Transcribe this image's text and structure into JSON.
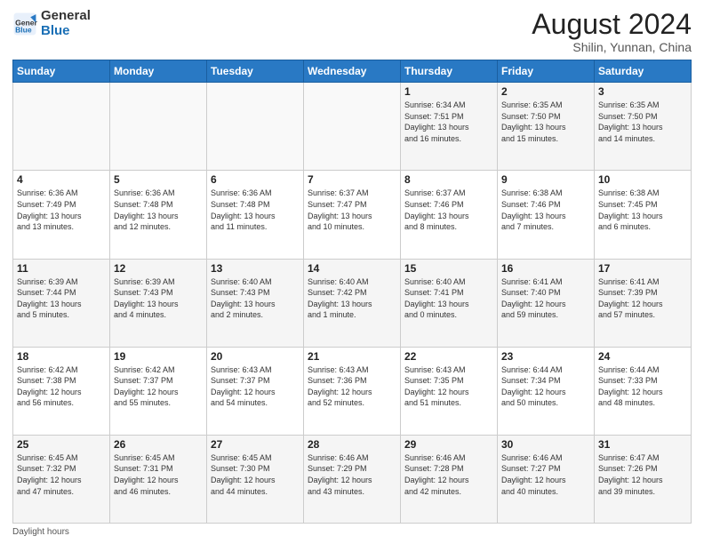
{
  "header": {
    "logo_line1": "General",
    "logo_line2": "Blue",
    "main_title": "August 2024",
    "sub_title": "Shilin, Yunnan, China"
  },
  "days_of_week": [
    "Sunday",
    "Monday",
    "Tuesday",
    "Wednesday",
    "Thursday",
    "Friday",
    "Saturday"
  ],
  "weeks": [
    [
      {
        "day": "",
        "detail": ""
      },
      {
        "day": "",
        "detail": ""
      },
      {
        "day": "",
        "detail": ""
      },
      {
        "day": "",
        "detail": ""
      },
      {
        "day": "1",
        "detail": "Sunrise: 6:34 AM\nSunset: 7:51 PM\nDaylight: 13 hours\nand 16 minutes."
      },
      {
        "day": "2",
        "detail": "Sunrise: 6:35 AM\nSunset: 7:50 PM\nDaylight: 13 hours\nand 15 minutes."
      },
      {
        "day": "3",
        "detail": "Sunrise: 6:35 AM\nSunset: 7:50 PM\nDaylight: 13 hours\nand 14 minutes."
      }
    ],
    [
      {
        "day": "4",
        "detail": "Sunrise: 6:36 AM\nSunset: 7:49 PM\nDaylight: 13 hours\nand 13 minutes."
      },
      {
        "day": "5",
        "detail": "Sunrise: 6:36 AM\nSunset: 7:48 PM\nDaylight: 13 hours\nand 12 minutes."
      },
      {
        "day": "6",
        "detail": "Sunrise: 6:36 AM\nSunset: 7:48 PM\nDaylight: 13 hours\nand 11 minutes."
      },
      {
        "day": "7",
        "detail": "Sunrise: 6:37 AM\nSunset: 7:47 PM\nDaylight: 13 hours\nand 10 minutes."
      },
      {
        "day": "8",
        "detail": "Sunrise: 6:37 AM\nSunset: 7:46 PM\nDaylight: 13 hours\nand 8 minutes."
      },
      {
        "day": "9",
        "detail": "Sunrise: 6:38 AM\nSunset: 7:46 PM\nDaylight: 13 hours\nand 7 minutes."
      },
      {
        "day": "10",
        "detail": "Sunrise: 6:38 AM\nSunset: 7:45 PM\nDaylight: 13 hours\nand 6 minutes."
      }
    ],
    [
      {
        "day": "11",
        "detail": "Sunrise: 6:39 AM\nSunset: 7:44 PM\nDaylight: 13 hours\nand 5 minutes."
      },
      {
        "day": "12",
        "detail": "Sunrise: 6:39 AM\nSunset: 7:43 PM\nDaylight: 13 hours\nand 4 minutes."
      },
      {
        "day": "13",
        "detail": "Sunrise: 6:40 AM\nSunset: 7:43 PM\nDaylight: 13 hours\nand 2 minutes."
      },
      {
        "day": "14",
        "detail": "Sunrise: 6:40 AM\nSunset: 7:42 PM\nDaylight: 13 hours\nand 1 minute."
      },
      {
        "day": "15",
        "detail": "Sunrise: 6:40 AM\nSunset: 7:41 PM\nDaylight: 13 hours\nand 0 minutes."
      },
      {
        "day": "16",
        "detail": "Sunrise: 6:41 AM\nSunset: 7:40 PM\nDaylight: 12 hours\nand 59 minutes."
      },
      {
        "day": "17",
        "detail": "Sunrise: 6:41 AM\nSunset: 7:39 PM\nDaylight: 12 hours\nand 57 minutes."
      }
    ],
    [
      {
        "day": "18",
        "detail": "Sunrise: 6:42 AM\nSunset: 7:38 PM\nDaylight: 12 hours\nand 56 minutes."
      },
      {
        "day": "19",
        "detail": "Sunrise: 6:42 AM\nSunset: 7:37 PM\nDaylight: 12 hours\nand 55 minutes."
      },
      {
        "day": "20",
        "detail": "Sunrise: 6:43 AM\nSunset: 7:37 PM\nDaylight: 12 hours\nand 54 minutes."
      },
      {
        "day": "21",
        "detail": "Sunrise: 6:43 AM\nSunset: 7:36 PM\nDaylight: 12 hours\nand 52 minutes."
      },
      {
        "day": "22",
        "detail": "Sunrise: 6:43 AM\nSunset: 7:35 PM\nDaylight: 12 hours\nand 51 minutes."
      },
      {
        "day": "23",
        "detail": "Sunrise: 6:44 AM\nSunset: 7:34 PM\nDaylight: 12 hours\nand 50 minutes."
      },
      {
        "day": "24",
        "detail": "Sunrise: 6:44 AM\nSunset: 7:33 PM\nDaylight: 12 hours\nand 48 minutes."
      }
    ],
    [
      {
        "day": "25",
        "detail": "Sunrise: 6:45 AM\nSunset: 7:32 PM\nDaylight: 12 hours\nand 47 minutes."
      },
      {
        "day": "26",
        "detail": "Sunrise: 6:45 AM\nSunset: 7:31 PM\nDaylight: 12 hours\nand 46 minutes."
      },
      {
        "day": "27",
        "detail": "Sunrise: 6:45 AM\nSunset: 7:30 PM\nDaylight: 12 hours\nand 44 minutes."
      },
      {
        "day": "28",
        "detail": "Sunrise: 6:46 AM\nSunset: 7:29 PM\nDaylight: 12 hours\nand 43 minutes."
      },
      {
        "day": "29",
        "detail": "Sunrise: 6:46 AM\nSunset: 7:28 PM\nDaylight: 12 hours\nand 42 minutes."
      },
      {
        "day": "30",
        "detail": "Sunrise: 6:46 AM\nSunset: 7:27 PM\nDaylight: 12 hours\nand 40 minutes."
      },
      {
        "day": "31",
        "detail": "Sunrise: 6:47 AM\nSunset: 7:26 PM\nDaylight: 12 hours\nand 39 minutes."
      }
    ]
  ],
  "footer": {
    "note": "Daylight hours"
  }
}
